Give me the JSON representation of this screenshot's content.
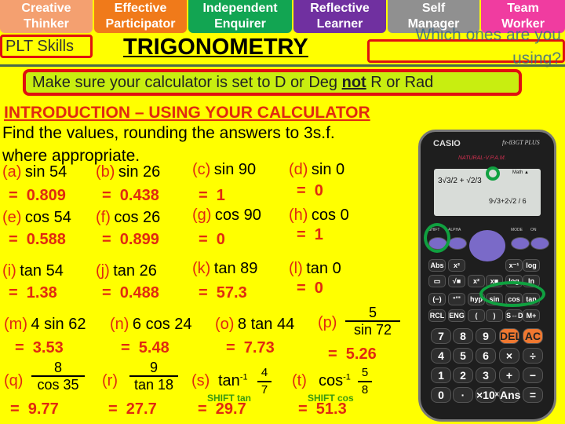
{
  "plt_tabs": [
    {
      "line1": "Creative",
      "line2": "Thinker",
      "color": "#f4a070"
    },
    {
      "line1": "Effective",
      "line2": "Participator",
      "color": "#f07a1a"
    },
    {
      "line1": "Independent",
      "line2": "Enquirer",
      "color": "#12a552"
    },
    {
      "line1": "Reflective",
      "line2": "Learner",
      "color": "#7030a0"
    },
    {
      "line1": "Self",
      "line2": "Manager",
      "color": "#909090"
    },
    {
      "line1": "Team",
      "line2": "Worker",
      "color": "#f03ca0"
    }
  ],
  "plt_label": "PLT Skills",
  "title": "TRIGONOMETRY",
  "question": "Which ones are you using?",
  "banner": {
    "before": "Make sure your calculator is set to D or Deg ",
    "emph": "not",
    "after": " R or Rad"
  },
  "intro_heading": "INTRODUCTION – USING YOUR CALCULATOR",
  "instructions": [
    "Find the values, rounding the answers to 3s.f.",
    "where appropriate."
  ],
  "problems": [
    {
      "label": "(a)",
      "expr": "sin 54",
      "answer": "=  0.809"
    },
    {
      "label": "(b)",
      "expr": "sin 26",
      "answer": "=  0.438"
    },
    {
      "label": "(c)",
      "expr": "sin 90",
      "answer": "=  1"
    },
    {
      "label": "(d)",
      "expr": "sin 0",
      "answer": "=  0"
    },
    {
      "label": "(e)",
      "expr": "cos 54",
      "answer": "=  0.588"
    },
    {
      "label": "(f)",
      "expr": "cos 26",
      "answer": "=  0.899"
    },
    {
      "label": "(g)",
      "expr": "cos 90",
      "answer": "=  0"
    },
    {
      "label": "(h)",
      "expr": "cos 0",
      "answer": "=  1"
    },
    {
      "label": "(i)",
      "expr": "tan 54",
      "answer": "=  1.38"
    },
    {
      "label": "(j)",
      "expr": "tan 26",
      "answer": "=  0.488"
    },
    {
      "label": "(k)",
      "expr": "tan 89",
      "answer": "=  57.3"
    },
    {
      "label": "(l)",
      "expr": "tan 0",
      "answer": "=  0"
    },
    {
      "label": "(m)",
      "expr": "4 sin 62",
      "answer": "=  3.53"
    },
    {
      "label": "(n)",
      "expr": "6 cos 24",
      "answer": "=  5.48"
    },
    {
      "label": "(o)",
      "expr": "8 tan 44",
      "answer": "=  7.73"
    },
    {
      "label": "(p)",
      "num": "5",
      "den": "sin 72",
      "answer": "=  5.26"
    },
    {
      "label": "(q)",
      "num": "8",
      "den": "cos 35",
      "answer": "=  9.77"
    },
    {
      "label": "(r)",
      "num": "9",
      "den": "tan 18",
      "answer": "=  27.7"
    },
    {
      "label": "(s)",
      "fn": "tan",
      "sup": "-1",
      "num": "4",
      "den": "7",
      "hint": "SHIFT tan",
      "answer": "=  29.7"
    },
    {
      "label": "(t)",
      "fn": "cos",
      "sup": "-1",
      "num": "5",
      "den": "8",
      "hint": "SHIFT cos",
      "answer": "=  51.3"
    }
  ],
  "calculator": {
    "brand": "CASIO",
    "model": "fx-83GT PLUS",
    "tagline": "NATURAL-V.P.A.M.",
    "screen_left": "3√3/2 + √2/3",
    "screen_right": "9√3+2√2 / 6",
    "mode": "Math ▲",
    "top_keys": [
      "SHIFT",
      "ALPHA",
      "MODE",
      "ON"
    ],
    "rows": [
      [
        "Abs",
        "x²",
        "",
        "",
        "x⁻¹",
        "log"
      ],
      [
        "▭",
        "√■",
        "x²",
        "x■",
        "log",
        "ln"
      ],
      [
        "(−)",
        "°'\"",
        "hyp",
        "sin",
        "cos",
        "tan"
      ],
      [
        "RCL",
        "ENG",
        "(",
        ")",
        "S⇔D",
        "M+"
      ],
      [
        "7",
        "8",
        "9",
        "DEL",
        "AC"
      ],
      [
        "4",
        "5",
        "6",
        "×",
        "÷"
      ],
      [
        "1",
        "2",
        "3",
        "+",
        "−"
      ],
      [
        "0",
        "·",
        "×10ˣ",
        "Ans",
        "="
      ]
    ],
    "highlight_color": "#10a040"
  }
}
